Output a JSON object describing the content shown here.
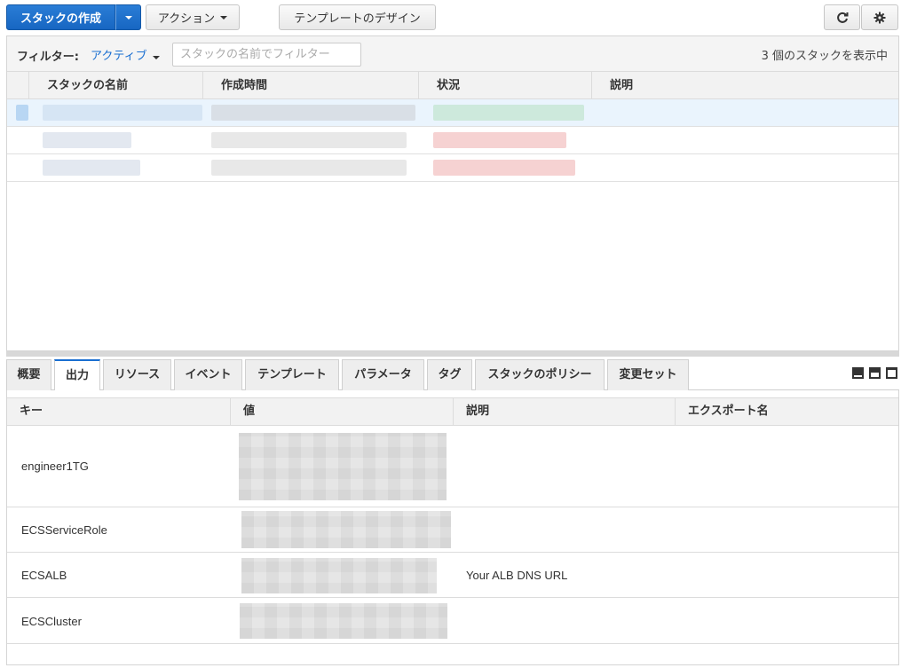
{
  "toolbar": {
    "create_stack_label": "スタックの作成",
    "actions_label": "アクション",
    "design_template_label": "テンプレートのデザイン"
  },
  "filter": {
    "label": "フィルター:",
    "status_value": "アクティブ",
    "placeholder": "スタックの名前でフィルター",
    "count_text": "3 個のスタックを表示中"
  },
  "stack_table": {
    "columns": [
      "スタックの名前",
      "作成時間",
      "状況",
      "説明"
    ]
  },
  "tabs": [
    "概要",
    "出力",
    "リソース",
    "イベント",
    "テンプレート",
    "パラメータ",
    "タグ",
    "スタックのポリシー",
    "変更セット"
  ],
  "active_tab": "出力",
  "outputs": {
    "columns": [
      "キー",
      "値",
      "説明",
      "エクスポート名"
    ],
    "rows": [
      {
        "key": "engineer1TG",
        "description": ""
      },
      {
        "key": "ECSServiceRole",
        "description": ""
      },
      {
        "key": "ECSALB",
        "description": "Your ALB DNS URL"
      },
      {
        "key": "ECSCluster",
        "description": ""
      }
    ]
  },
  "colors": {
    "primary": "#1766c2",
    "link": "#1a6fd1",
    "status_green": "#cde9dc",
    "status_red": "#f6d2d2",
    "selected_row": "#eaf4fd"
  },
  "icons": [
    "refresh-icon",
    "gear-icon",
    "caret-down-icon",
    "layout-bottom-icon",
    "layout-split-icon",
    "layout-top-icon"
  ]
}
